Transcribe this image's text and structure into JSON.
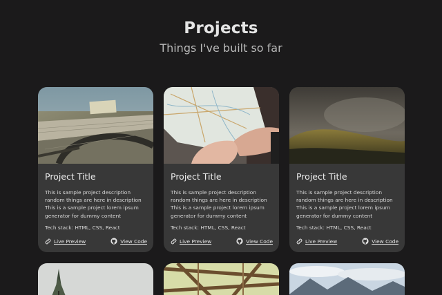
{
  "header": {
    "title": "Projects",
    "subtitle": "Things I've built so far"
  },
  "projects": [
    {
      "title": "Project Title",
      "description": "This is sample project description random things are here in description This is a sample project lorem ipsum generator for dummy content",
      "tech_stack": "Tech stack: HTML, CSS, React",
      "preview_label": "Live Preview",
      "code_label": "View Code",
      "image": "architect-blueprint-photo"
    },
    {
      "title": "Project Title",
      "description": "This is sample project description random things are here in description This is a sample project lorem ipsum generator for dummy content",
      "tech_stack": "Tech stack: HTML, CSS, React",
      "preview_label": "Live Preview",
      "code_label": "View Code",
      "image": "hands-holding-map-photo"
    },
    {
      "title": "Project Title",
      "description": "This is sample project description random things are here in description This is a sample project lorem ipsum generator for dummy content",
      "tech_stack": "Tech stack: HTML, CSS, React",
      "preview_label": "Live Preview",
      "code_label": "View Code",
      "image": "hillside-landscape-photo"
    }
  ],
  "next_row_images": [
    "pine-tree-photo",
    "wooden-structure-photo",
    "mountain-lake-photo"
  ],
  "icons": {
    "preview": "link-icon",
    "code": "github-icon"
  },
  "colors": {
    "background": "#1b1a1b",
    "card": "#383838",
    "title": "#e5e5e5",
    "subtitle": "#b9b9b9"
  }
}
